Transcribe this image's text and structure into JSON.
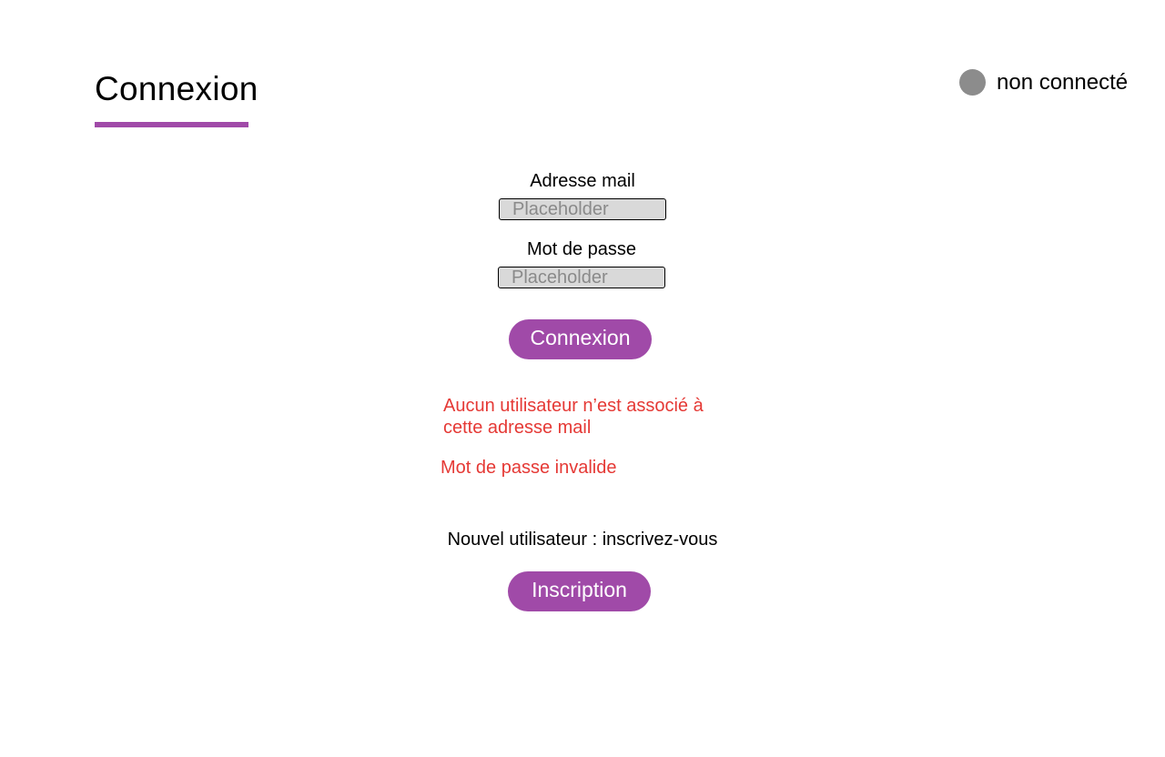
{
  "header": {
    "title": "Connexion",
    "accent_color": "#a04aa8"
  },
  "status": {
    "icon": "status-dot-icon",
    "color": "#8c8c8c",
    "text": "non connecté"
  },
  "form": {
    "email": {
      "label": "Adresse mail",
      "value": "",
      "placeholder": "Placeholder"
    },
    "password": {
      "label": "Mot de passe",
      "value": "",
      "placeholder": "Placeholder"
    },
    "submit_label": "Connexion"
  },
  "errors": {
    "color": "#e53935",
    "no_user_line1": "Aucun utilisateur n’est associé à",
    "no_user_line2": "cette adresse mail",
    "invalid_password": "Mot de passe invalide"
  },
  "signup": {
    "prompt": "Nouvel utilisateur : inscrivez-vous",
    "button_label": "Inscription"
  }
}
